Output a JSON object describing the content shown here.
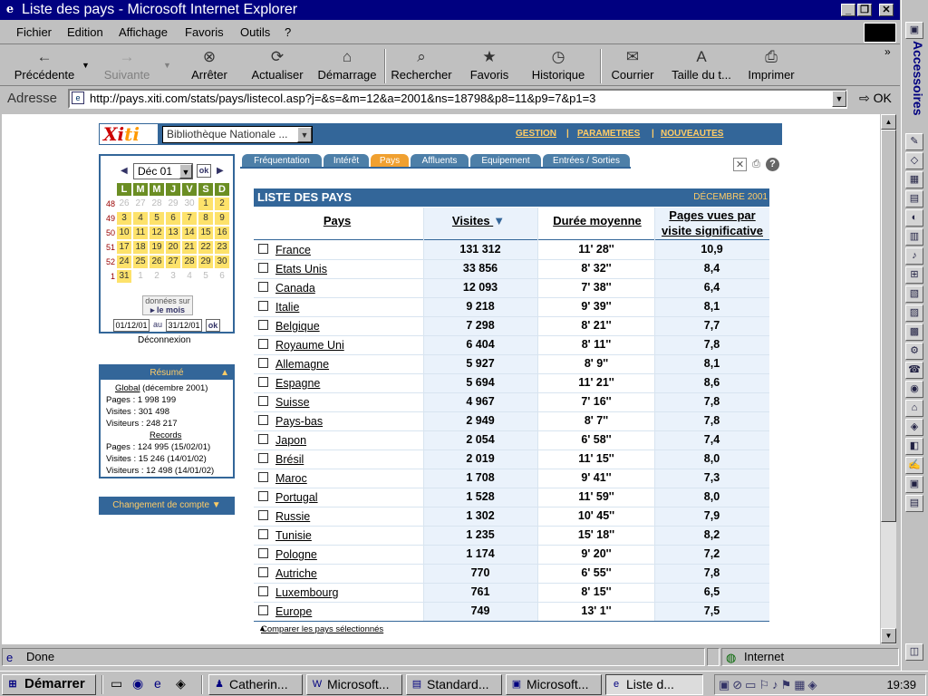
{
  "window": {
    "title": "Liste des pays - Microsoft Internet Explorer",
    "btn_min": "_",
    "btn_max": "❐",
    "btn_close": "✕"
  },
  "menu": [
    "Fichier",
    "Edition",
    "Affichage",
    "Favoris",
    "Outils",
    "?"
  ],
  "toolbar": [
    {
      "label": "Précédente",
      "icon": "←",
      "enabled": true
    },
    {
      "label": "Suivante",
      "icon": "→",
      "enabled": false
    },
    {
      "label": "Arrêter",
      "icon": "⊗",
      "enabled": true
    },
    {
      "label": "Actualiser",
      "icon": "⟳",
      "enabled": true
    },
    {
      "label": "Démarrage",
      "icon": "⌂",
      "enabled": true
    },
    {
      "label": "Rechercher",
      "icon": "⌕",
      "enabled": true
    },
    {
      "label": "Favoris",
      "icon": "★",
      "enabled": true
    },
    {
      "label": "Historique",
      "icon": "◷",
      "enabled": true
    },
    {
      "label": "Courrier",
      "icon": "✉",
      "enabled": true
    },
    {
      "label": "Taille du t...",
      "icon": "A",
      "enabled": true
    },
    {
      "label": "Imprimer",
      "icon": "⎙",
      "enabled": true
    }
  ],
  "address": {
    "label": "Adresse",
    "url": "http://pays.xiti.com/stats/pays/listecol.asp?j=&s=&m=12&a=2001&ns=18798&p8=11&p9=7&p1=3",
    "go": "OK"
  },
  "sidebar_title": "Accessoires",
  "xiti": {
    "logo_a": "Xi",
    "logo_b": "ti",
    "site": "Bibliothèque Nationale ...",
    "links": [
      "GESTION",
      "PARAMETRES",
      "NOUVEAUTES"
    ]
  },
  "calendar": {
    "month": "Déc 01",
    "ok": "ok",
    "days": [
      "L",
      "M",
      "M",
      "J",
      "V",
      "S",
      "D"
    ],
    "weeks": [
      {
        "wk": "48",
        "days": [
          "26",
          "27",
          "28",
          "29",
          "30",
          "1",
          "2"
        ],
        "outside": [
          true,
          true,
          true,
          true,
          true,
          false,
          false
        ]
      },
      {
        "wk": "49",
        "days": [
          "3",
          "4",
          "5",
          "6",
          "7",
          "8",
          "9"
        ],
        "outside": [
          false,
          false,
          false,
          false,
          false,
          false,
          false
        ]
      },
      {
        "wk": "50",
        "days": [
          "10",
          "11",
          "12",
          "13",
          "14",
          "15",
          "16"
        ],
        "outside": [
          false,
          false,
          false,
          false,
          false,
          false,
          false
        ]
      },
      {
        "wk": "51",
        "days": [
          "17",
          "18",
          "19",
          "20",
          "21",
          "22",
          "23"
        ],
        "outside": [
          false,
          false,
          false,
          false,
          false,
          false,
          false
        ]
      },
      {
        "wk": "52",
        "days": [
          "24",
          "25",
          "26",
          "27",
          "28",
          "29",
          "30"
        ],
        "outside": [
          false,
          false,
          false,
          false,
          false,
          false,
          false
        ]
      },
      {
        "wk": "1",
        "days": [
          "31",
          "1",
          "2",
          "3",
          "4",
          "5",
          "6"
        ],
        "outside": [
          false,
          true,
          true,
          true,
          true,
          true,
          true
        ]
      }
    ],
    "donnees_line1": "données sur",
    "donnees_line2": "le mois",
    "from": "01/12/01",
    "au": "au",
    "to": "31/12/01",
    "deconnexion": "Déconnexion"
  },
  "resume": {
    "title": "Résumé",
    "global_label": "Global",
    "global_period": "(décembre 2001)",
    "pages": "Pages : 1 998 199",
    "visites": "Visites : 301 498",
    "visiteurs": "Visiteurs : 248 217",
    "records_label": "Records",
    "rec_pages": "Pages : 124 995 (15/02/01)",
    "rec_visites": "Visites : 15 246 (14/01/02)",
    "rec_visiteurs": "Visiteurs : 12 498 (14/01/02)"
  },
  "changement": "Changement de compte",
  "tabs": [
    "Fréquentation",
    "Intérêt",
    "Pays",
    "Affluents",
    "Equipement",
    "Entrées / Sorties"
  ],
  "active_tab": "Pays",
  "list": {
    "title": "LISTE DES PAYS",
    "month": "DÉCEMBRE 2001",
    "columns": [
      "Pays",
      "Visites",
      "Durée moyenne",
      "Pages vues par",
      "visite significative"
    ],
    "rows": [
      {
        "pays": "France",
        "visites": "131 312",
        "duree": "11' 28''",
        "pages": "10,9"
      },
      {
        "pays": "Etats Unis",
        "visites": "33 856",
        "duree": "8' 32''",
        "pages": "8,4"
      },
      {
        "pays": "Canada",
        "visites": "12 093",
        "duree": "7' 38''",
        "pages": "6,4"
      },
      {
        "pays": "Italie",
        "visites": "9 218",
        "duree": "9' 39''",
        "pages": "8,1"
      },
      {
        "pays": "Belgique",
        "visites": "7 298",
        "duree": "8' 21''",
        "pages": "7,7"
      },
      {
        "pays": "Royaume Uni",
        "visites": "6 404",
        "duree": "8' 11''",
        "pages": "7,8"
      },
      {
        "pays": "Allemagne",
        "visites": "5 927",
        "duree": "8' 9''",
        "pages": "8,1"
      },
      {
        "pays": "Espagne",
        "visites": "5 694",
        "duree": "11' 21''",
        "pages": "8,6"
      },
      {
        "pays": "Suisse",
        "visites": "4 967",
        "duree": "7' 16''",
        "pages": "7,8"
      },
      {
        "pays": "Pays-bas",
        "visites": "2 949",
        "duree": "8' 7''",
        "pages": "7,8"
      },
      {
        "pays": "Japon",
        "visites": "2 054",
        "duree": "6' 58''",
        "pages": "7,4"
      },
      {
        "pays": "Brésil",
        "visites": "2 019",
        "duree": "11' 15''",
        "pages": "8,0"
      },
      {
        "pays": "Maroc",
        "visites": "1 708",
        "duree": "9' 41''",
        "pages": "7,3"
      },
      {
        "pays": "Portugal",
        "visites": "1 528",
        "duree": "11' 59''",
        "pages": "8,0"
      },
      {
        "pays": "Russie",
        "visites": "1 302",
        "duree": "10' 45''",
        "pages": "7,9"
      },
      {
        "pays": "Tunisie",
        "visites": "1 235",
        "duree": "15' 18''",
        "pages": "8,2"
      },
      {
        "pays": "Pologne",
        "visites": "1 174",
        "duree": "9' 20''",
        "pages": "7,2"
      },
      {
        "pays": "Autriche",
        "visites": "770",
        "duree": "6' 55''",
        "pages": "7,8"
      },
      {
        "pays": "Luxembourg",
        "visites": "761",
        "duree": "8' 15''",
        "pages": "6,5"
      },
      {
        "pays": "Europe",
        "visites": "749",
        "duree": "13' 1''",
        "pages": "7,5"
      }
    ],
    "compare": "Comparer les pays sélectionnés"
  },
  "status": {
    "text": "Done",
    "zone": "Internet"
  },
  "taskbar": {
    "start": "Démarrer",
    "tasks": [
      {
        "label": "Catherin...",
        "active": false
      },
      {
        "label": "Microsoft...",
        "active": false
      },
      {
        "label": "Standard...",
        "active": false
      },
      {
        "label": "Microsoft...",
        "active": false
      },
      {
        "label": "Liste d...",
        "active": true
      }
    ],
    "clock": "19:39"
  },
  "colors": {
    "xiti_blue": "#336699",
    "tab_active": "#f0a030",
    "cal_day": "#fde26b",
    "cal_header": "#6b8e23"
  }
}
